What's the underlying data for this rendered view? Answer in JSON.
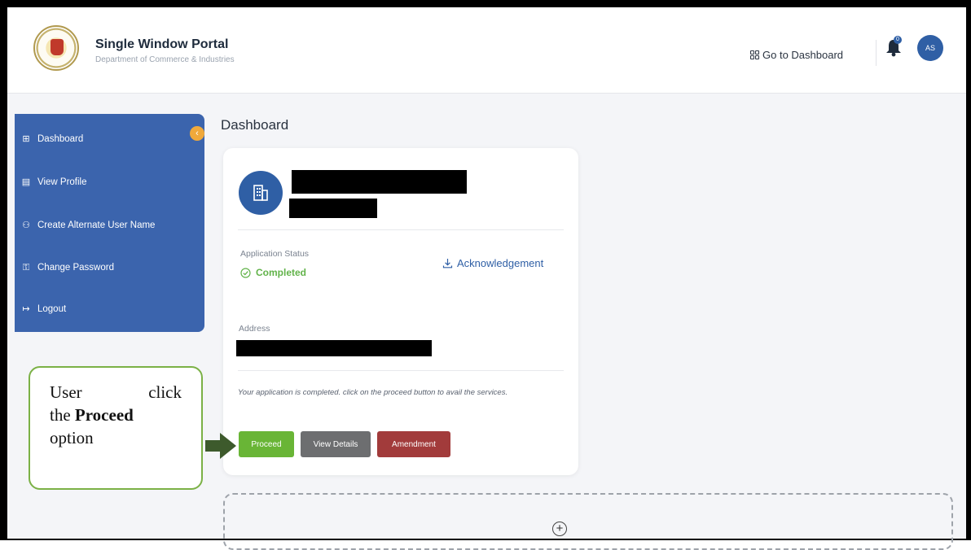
{
  "header": {
    "title": "Single Window Portal",
    "subtitle": "Department of Commerce & Industries",
    "goto_dashboard_label": "Go to Dashboard",
    "notification_count": "0",
    "avatar_initials": "AS"
  },
  "sidebar": {
    "items": [
      {
        "label": "Dashboard",
        "icon": "grid-icon"
      },
      {
        "label": "View Profile",
        "icon": "profile-doc-icon"
      },
      {
        "label": "Create Alternate User Name",
        "icon": "user-add-icon"
      },
      {
        "label": "Change Password",
        "icon": "password-icon"
      },
      {
        "label": "Logout",
        "icon": "logout-icon"
      }
    ]
  },
  "main": {
    "page_title": "Dashboard",
    "card": {
      "status_label": "Application Status",
      "status_value": "Completed",
      "acknowledgement_label": "Acknowledgement",
      "address_label": "Address",
      "note": "Your application is completed. click on the proceed button to avail the services.",
      "buttons": {
        "proceed": "Proceed",
        "view_details": "View Details",
        "amendment": "Amendment"
      }
    },
    "add_icon": "plus-circle-icon"
  },
  "annotation": {
    "line1_word1": "User",
    "line1_word2": "click",
    "line2_prefix": "the",
    "line2_bold": "Proceed",
    "line3": "option"
  },
  "colors": {
    "primary": "#3b64ad",
    "accent": "#f0a93b",
    "success": "#62b34a",
    "proceed": "#69b536",
    "view_details": "#6d6e70",
    "amendment": "#a23b3b",
    "callout_border": "#7bb146",
    "arrow": "#3d5a2c"
  }
}
